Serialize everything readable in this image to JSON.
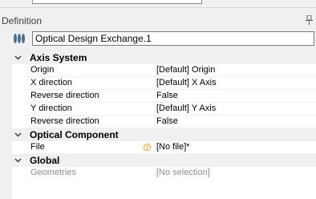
{
  "definition": {
    "title": "Definition"
  },
  "name_field": {
    "value": "Optical Design Exchange.1"
  },
  "sections": [
    {
      "title": "Axis System",
      "rows": [
        {
          "name": "Origin",
          "value": "[Default] Origin"
        },
        {
          "name": "X direction",
          "value": "[Default] X Axis"
        },
        {
          "name": "Reverse direction",
          "value": "False"
        },
        {
          "name": "Y direction",
          "value": "[Default] Y Axis"
        },
        {
          "name": "Reverse direction",
          "value": "False"
        }
      ]
    },
    {
      "title": "Optical Component",
      "rows": [
        {
          "name": "File",
          "value": "[No file]*",
          "icon": "warning-icon"
        }
      ]
    },
    {
      "title": "Global",
      "rows": [
        {
          "name": "Geometries",
          "value": "[No selection]",
          "disabled": true
        }
      ]
    }
  ],
  "colors": {
    "panel": "#f0f0f0",
    "grid": "#ffffff",
    "warning": "#e8a317",
    "disabled_text": "#8c8c8c"
  }
}
